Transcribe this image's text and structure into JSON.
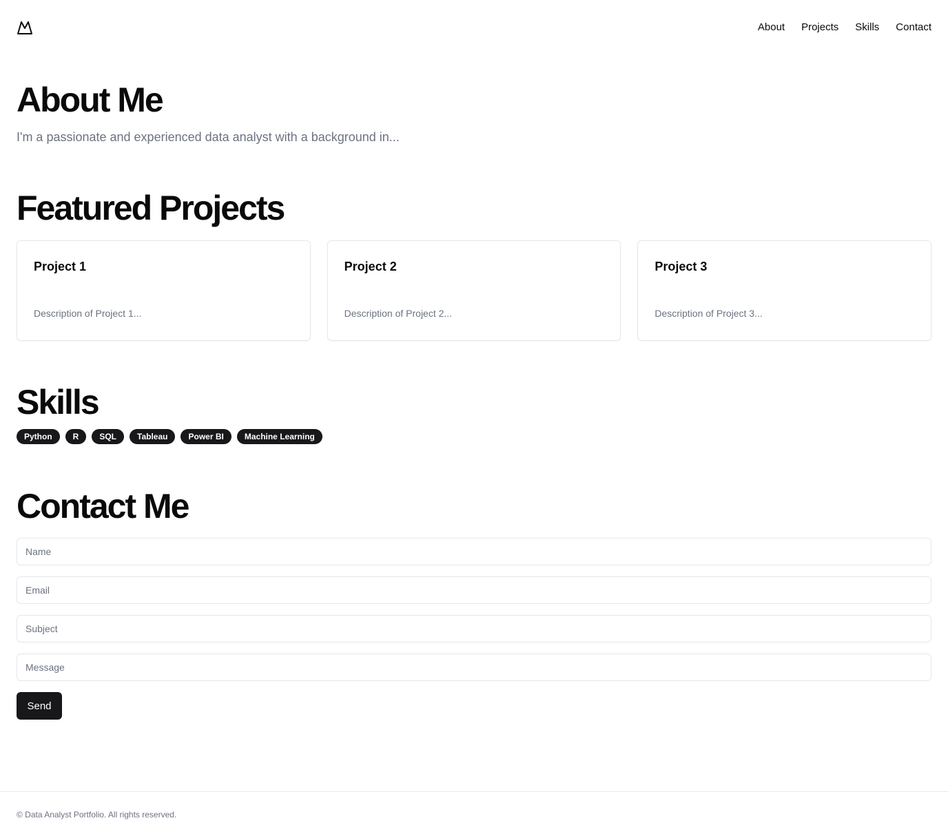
{
  "header": {
    "logo_icon": "mountain-icon",
    "nav": [
      {
        "label": "About"
      },
      {
        "label": "Projects"
      },
      {
        "label": "Skills"
      },
      {
        "label": "Contact"
      }
    ]
  },
  "about": {
    "title": "About Me",
    "text": "I'm a passionate and experienced data analyst with a background in..."
  },
  "projects": {
    "title": "Featured Projects",
    "items": [
      {
        "title": "Project 1",
        "description": "Description of Project 1..."
      },
      {
        "title": "Project 2",
        "description": "Description of Project 2..."
      },
      {
        "title": "Project 3",
        "description": "Description of Project 3..."
      }
    ]
  },
  "skills": {
    "title": "Skills",
    "items": [
      "Python",
      "R",
      "SQL",
      "Tableau",
      "Power BI",
      "Machine Learning"
    ]
  },
  "contact": {
    "title": "Contact Me",
    "name_placeholder": "Name",
    "email_placeholder": "Email",
    "subject_placeholder": "Subject",
    "message_placeholder": "Message",
    "send_label": "Send"
  },
  "footer": {
    "text": "© Data Analyst Portfolio. All rights reserved."
  },
  "colors": {
    "primary": "#18181b",
    "muted_text": "#6b7280",
    "border": "#e5e7eb"
  }
}
